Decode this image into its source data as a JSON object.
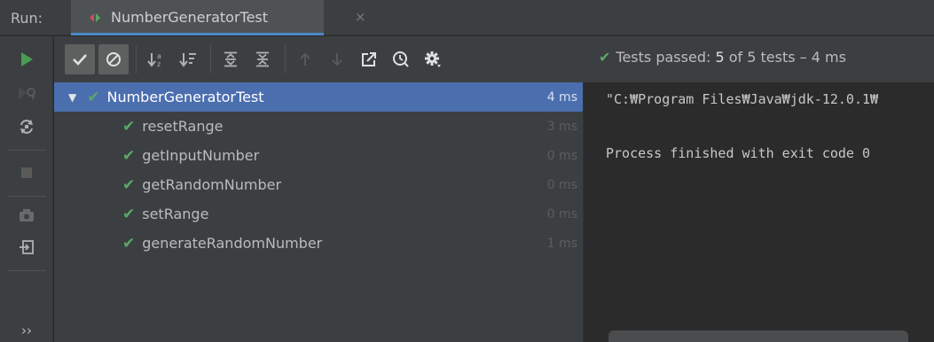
{
  "header": {
    "run_label": "Run:",
    "tab_title": "NumberGeneratorTest",
    "tab_close": "×"
  },
  "toolbar": {
    "status_prefix": "Tests passed: ",
    "status_passed": "5",
    "status_of": " of 5 tests – 4 ms"
  },
  "tree": {
    "root": {
      "name": "NumberGeneratorTest",
      "time": "4 ms"
    },
    "items": [
      {
        "name": "resetRange",
        "time": "3 ms"
      },
      {
        "name": "getInputNumber",
        "time": "0 ms"
      },
      {
        "name": "getRandomNumber",
        "time": "0 ms"
      },
      {
        "name": "setRange",
        "time": "0 ms"
      },
      {
        "name": "generateRandomNumber",
        "time": "1 ms"
      }
    ]
  },
  "console": {
    "lines": [
      "\"C:₩Program Files₩Java₩jdk-12.0.1₩",
      "",
      "Process finished with exit code 0"
    ]
  },
  "left_bar": {
    "more_label": "››"
  },
  "colors": {
    "pass_green": "#59a869",
    "run_green": "#499c54",
    "selection_blue": "#4b6eaf",
    "panel_bg": "#3c3f41",
    "editor_bg": "#2b2b2b"
  }
}
